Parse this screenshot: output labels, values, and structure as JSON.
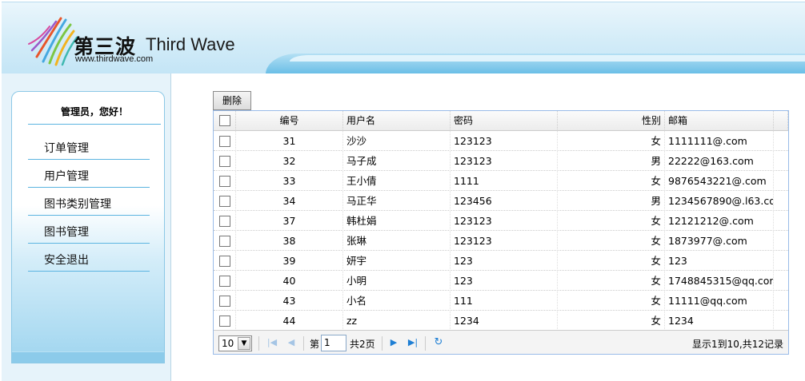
{
  "header": {
    "brand_cn": "第三波",
    "brand_en": "Third Wave",
    "url": "www.thirdwave.com"
  },
  "sidebar": {
    "welcome": "管理员，您好！",
    "items": [
      {
        "label": "订单管理"
      },
      {
        "label": "用户管理"
      },
      {
        "label": "图书类别管理"
      },
      {
        "label": "图书管理"
      },
      {
        "label": "安全退出"
      }
    ]
  },
  "toolbar": {
    "delete_label": "删除"
  },
  "grid": {
    "columns": {
      "id": "编号",
      "username": "用户名",
      "password": "密码",
      "gender": "性别",
      "email": "邮箱"
    },
    "rows": [
      {
        "id": "31",
        "username": "沙沙",
        "password": "123123",
        "gender": "女",
        "email": "1111111@.com"
      },
      {
        "id": "32",
        "username": "马子成",
        "password": "123123",
        "gender": "男",
        "email": "22222@163.com"
      },
      {
        "id": "33",
        "username": "王小倩",
        "password": "1111",
        "gender": "女",
        "email": "9876543221@.com"
      },
      {
        "id": "34",
        "username": "马正华",
        "password": "123456",
        "gender": "男",
        "email": "1234567890@.l63.co"
      },
      {
        "id": "37",
        "username": "韩杜娟",
        "password": "123123",
        "gender": "女",
        "email": "12121212@.com"
      },
      {
        "id": "38",
        "username": "张琳",
        "password": "123123",
        "gender": "女",
        "email": "1873977@.com"
      },
      {
        "id": "39",
        "username": "妍宇",
        "password": "123",
        "gender": "女",
        "email": "123"
      },
      {
        "id": "40",
        "username": "小明",
        "password": "123",
        "gender": "女",
        "email": "1748845315@qq.cor"
      },
      {
        "id": "43",
        "username": "小名",
        "password": "111",
        "gender": "女",
        "email": "11111@qq.com"
      },
      {
        "id": "44",
        "username": "zz",
        "password": "1234",
        "gender": "女",
        "email": "1234"
      }
    ]
  },
  "pager": {
    "page_size": "10",
    "page_prefix": "第",
    "page_value": "1",
    "page_total": "共2页",
    "info": "显示1到10,共12记录",
    "icons": {
      "first": "first-page-icon",
      "prev": "prev-page-icon",
      "next": "next-page-icon",
      "last": "last-page-icon",
      "refresh": "refresh-icon"
    }
  }
}
